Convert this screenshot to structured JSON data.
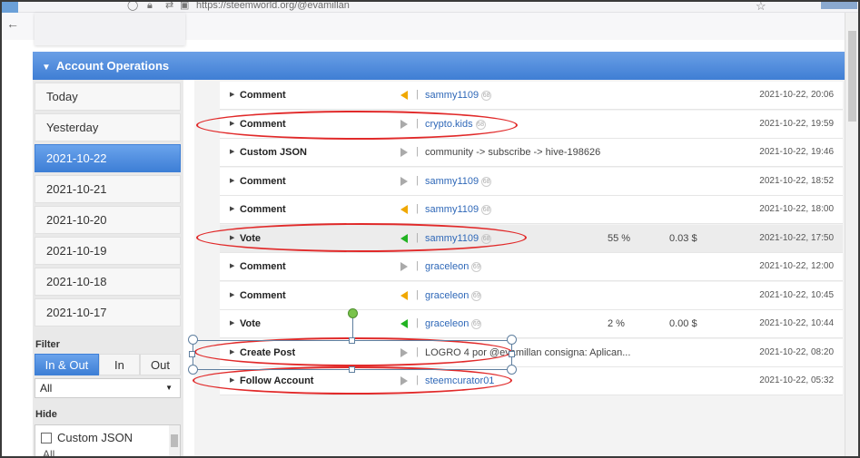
{
  "browser": {
    "url": "https://steemworld.org/@evamillan"
  },
  "header": {
    "title": "Account Operations"
  },
  "sidebar": {
    "days": [
      "Today",
      "Yesterday",
      "2021-10-22",
      "2021-10-21",
      "2021-10-20",
      "2021-10-19",
      "2021-10-18",
      "2021-10-17"
    ],
    "active_day": "2021-10-22",
    "filter_label": "Filter",
    "filter_buttons": [
      "In & Out",
      "In",
      "Out"
    ],
    "filter_active": "In & Out",
    "filter_select": "All",
    "hide_label": "Hide",
    "hide_option": "Custom JSON",
    "hide_select": "All"
  },
  "operations": [
    {
      "type": "Comment",
      "direction": "orange",
      "who": "sammy1109",
      "link": true,
      "badge": "68",
      "pct": "",
      "amount": "",
      "time": "2021-10-22, 20:06"
    },
    {
      "type": "Comment",
      "direction": "gray-right",
      "who": "crypto.kids",
      "link": true,
      "badge": "68",
      "pct": "",
      "amount": "",
      "time": "2021-10-22, 19:59"
    },
    {
      "type": "Custom JSON",
      "direction": "gray-right",
      "who": "community -> subscribe -> hive-198626",
      "link": false,
      "badge": "",
      "pct": "",
      "amount": "",
      "time": "2021-10-22, 19:46"
    },
    {
      "type": "Comment",
      "direction": "gray-right",
      "who": "sammy1109",
      "link": true,
      "badge": "68",
      "pct": "",
      "amount": "",
      "time": "2021-10-22, 18:52"
    },
    {
      "type": "Comment",
      "direction": "orange",
      "who": "sammy1109",
      "link": true,
      "badge": "68",
      "pct": "",
      "amount": "",
      "time": "2021-10-22, 18:00"
    },
    {
      "type": "Vote",
      "direction": "green",
      "who": "sammy1109",
      "link": true,
      "badge": "68",
      "pct": "55 %",
      "amount": "0.03 $",
      "time": "2021-10-22, 17:50"
    },
    {
      "type": "Comment",
      "direction": "gray-right",
      "who": "graceleon",
      "link": true,
      "badge": "69",
      "pct": "",
      "amount": "",
      "time": "2021-10-22, 12:00"
    },
    {
      "type": "Comment",
      "direction": "orange",
      "who": "graceleon",
      "link": true,
      "badge": "69",
      "pct": "",
      "amount": "",
      "time": "2021-10-22, 10:45"
    },
    {
      "type": "Vote",
      "direction": "green",
      "who": "graceleon",
      "link": true,
      "badge": "69",
      "pct": "2 %",
      "amount": "0.00 $",
      "time": "2021-10-22, 10:44"
    },
    {
      "type": "Create Post",
      "direction": "gray-right",
      "who": "LOGRO 4 por @evamillan consigna: Aplican...",
      "link": false,
      "badge": "",
      "pct": "",
      "amount": "",
      "time": "2021-10-22, 08:20"
    },
    {
      "type": "Follow Account",
      "direction": "gray-right",
      "who": "steemcurator01",
      "link": true,
      "badge": "",
      "pct": "",
      "amount": "",
      "time": "2021-10-22, 05:32"
    }
  ],
  "colors": {
    "accent": "#3f7ed4",
    "annotation": "#e12a2a",
    "incoming_orange": "#f0a800",
    "vote_green": "#22b322",
    "link": "#2f68b8"
  }
}
